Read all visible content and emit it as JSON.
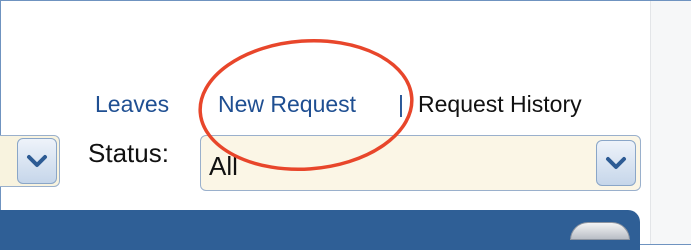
{
  "nav": {
    "leaves_label": "Leaves",
    "new_request_label": "New Request",
    "separator": "|",
    "request_history_label": "Request History"
  },
  "filters": {
    "status_label": "Status:",
    "status_value": "All"
  },
  "icons": {
    "dropdown": "chevron-down-icon",
    "annotation": "highlight-circle"
  },
  "colors": {
    "link": "#1f4f92",
    "annotation": "#e8462b",
    "header_bar": "#2f5f96",
    "select_bg": "#fbf6e6"
  }
}
